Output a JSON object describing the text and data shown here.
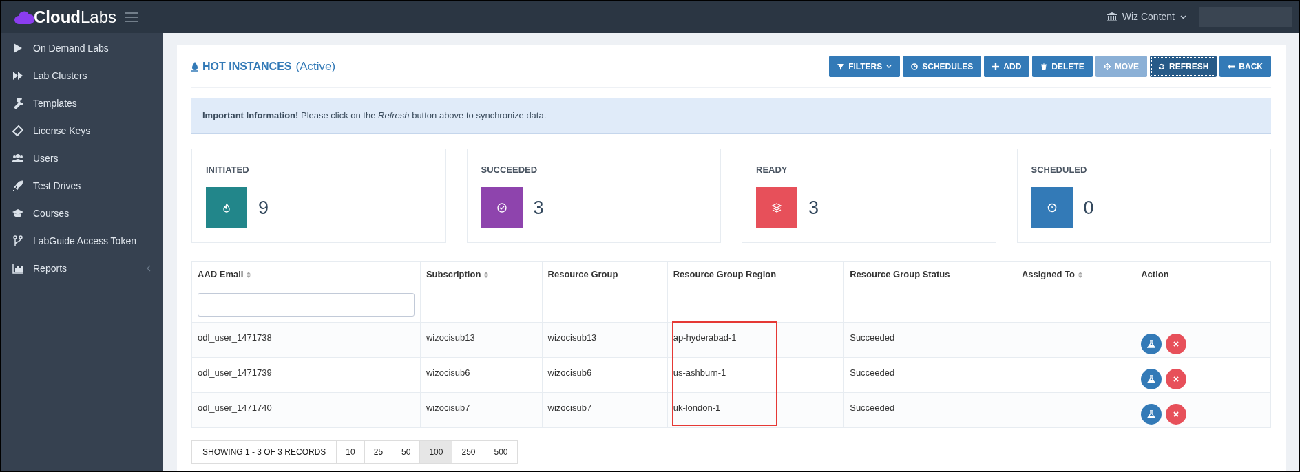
{
  "brand": {
    "bold": "Cloud",
    "light": "Labs"
  },
  "topbar": {
    "tenant": "Wiz Content"
  },
  "sidebar": {
    "items": [
      {
        "label": "On Demand Labs",
        "has_submenu": false
      },
      {
        "label": "Lab Clusters",
        "has_submenu": false
      },
      {
        "label": "Templates",
        "has_submenu": false
      },
      {
        "label": "License Keys",
        "has_submenu": false
      },
      {
        "label": "Users",
        "has_submenu": false
      },
      {
        "label": "Test Drives",
        "has_submenu": false
      },
      {
        "label": "Courses",
        "has_submenu": false
      },
      {
        "label": "LabGuide Access Token",
        "has_submenu": false
      },
      {
        "label": "Reports",
        "has_submenu": true
      }
    ]
  },
  "page": {
    "title": "HOT INSTANCES",
    "subtitle": "(Active)"
  },
  "toolbar": [
    {
      "label": "FILTERS",
      "disabled": false,
      "focused": false,
      "dropdown": true
    },
    {
      "label": "SCHEDULES",
      "disabled": false,
      "focused": false,
      "dropdown": false
    },
    {
      "label": "ADD",
      "disabled": false,
      "focused": false,
      "dropdown": false
    },
    {
      "label": "DELETE",
      "disabled": false,
      "focused": false,
      "dropdown": false
    },
    {
      "label": "MOVE",
      "disabled": true,
      "focused": false,
      "dropdown": false
    },
    {
      "label": "REFRESH",
      "disabled": false,
      "focused": true,
      "dropdown": false
    },
    {
      "label": "BACK",
      "disabled": false,
      "focused": false,
      "dropdown": false
    }
  ],
  "alert": "**Important Information!** Please click on the *Refresh* button above to synchronize data.",
  "stats": [
    {
      "label": "INITIATED",
      "value": "9",
      "color": "#22868a"
    },
    {
      "label": "SUCCEEDED",
      "value": "3",
      "color": "#8e44ad"
    },
    {
      "label": "READY",
      "value": "3",
      "color": "#e7505a"
    },
    {
      "label": "SCHEDULED",
      "value": "0",
      "color": "#337ab7"
    }
  ],
  "table": {
    "columns": [
      {
        "label": "AAD Email",
        "sortable": true
      },
      {
        "label": "Subscription",
        "sortable": true
      },
      {
        "label": "Resource Group",
        "sortable": false
      },
      {
        "label": "Resource Group Region",
        "sortable": false
      },
      {
        "label": "Resource Group Status",
        "sortable": false
      },
      {
        "label": "Assigned To",
        "sortable": true
      },
      {
        "label": "Action",
        "sortable": false
      }
    ],
    "rows": [
      [
        "odl_user_1471738",
        "wizocisub13",
        "wizocisub13",
        "ap-hyderabad-1",
        "Succeeded"
      ],
      [
        "odl_user_1471739",
        "wizocisub6",
        "wizocisub6",
        "us-ashburn-1",
        "Succeeded"
      ],
      [
        "odl_user_1471740",
        "wizocisub7",
        "wizocisub7",
        "uk-london-1",
        "Succeeded"
      ]
    ]
  },
  "pagination": {
    "summary": "SHOWING 1 - 3 OF 3 RECORDS",
    "sizes": [
      {
        "label": "10",
        "selected": false
      },
      {
        "label": "25",
        "selected": false
      },
      {
        "label": "50",
        "selected": false
      },
      {
        "label": "100",
        "selected": true
      },
      {
        "label": "250",
        "selected": false
      },
      {
        "label": "500",
        "selected": false
      }
    ]
  }
}
